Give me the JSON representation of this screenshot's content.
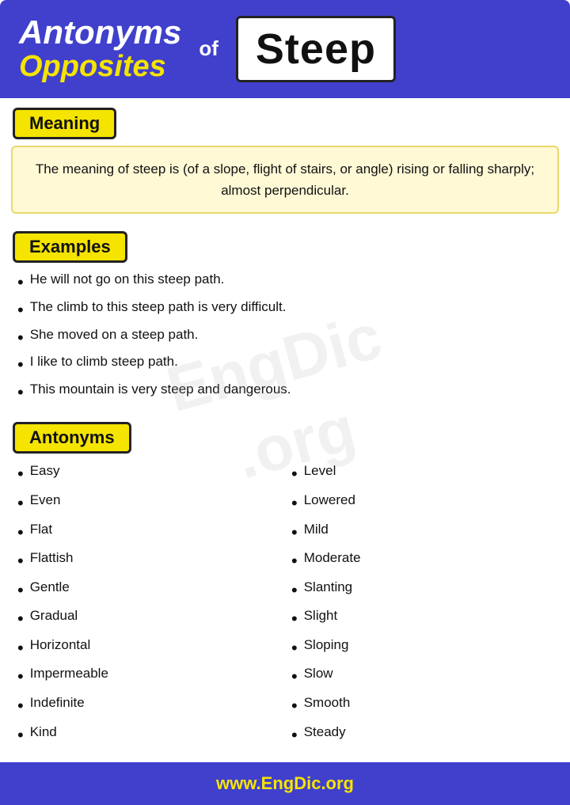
{
  "header": {
    "antonyms_label": "Antonyms",
    "opposites_label": "Opposites",
    "of_label": "of",
    "steep_label": "Steep"
  },
  "meaning": {
    "section_label": "Meaning",
    "text": "The meaning of steep is (of a slope, flight of stairs, or angle) rising or falling sharply; almost perpendicular."
  },
  "examples": {
    "section_label": "Examples",
    "items": [
      "He will not go on this steep path.",
      "The climb to this steep path is very difficult.",
      "She moved on a steep path.",
      "I like to climb steep path.",
      "This mountain is very steep and dangerous."
    ]
  },
  "antonyms": {
    "section_label": "Antonyms",
    "col1": [
      "Easy",
      "Even",
      "Flat",
      "Flattish",
      "Gentle",
      "Gradual",
      "Horizontal",
      "Impermeable",
      "Indefinite",
      "Kind"
    ],
    "col2": [
      "Level",
      "Lowered",
      "Mild",
      "Moderate",
      "Slanting",
      "Slight",
      "Sloping",
      "Slow",
      "Smooth",
      "Steady"
    ]
  },
  "footer": {
    "prefix": "www.",
    "brand": "EngDic",
    "suffix": ".org"
  },
  "watermark_lines": [
    "EngDic",
    ".org"
  ]
}
